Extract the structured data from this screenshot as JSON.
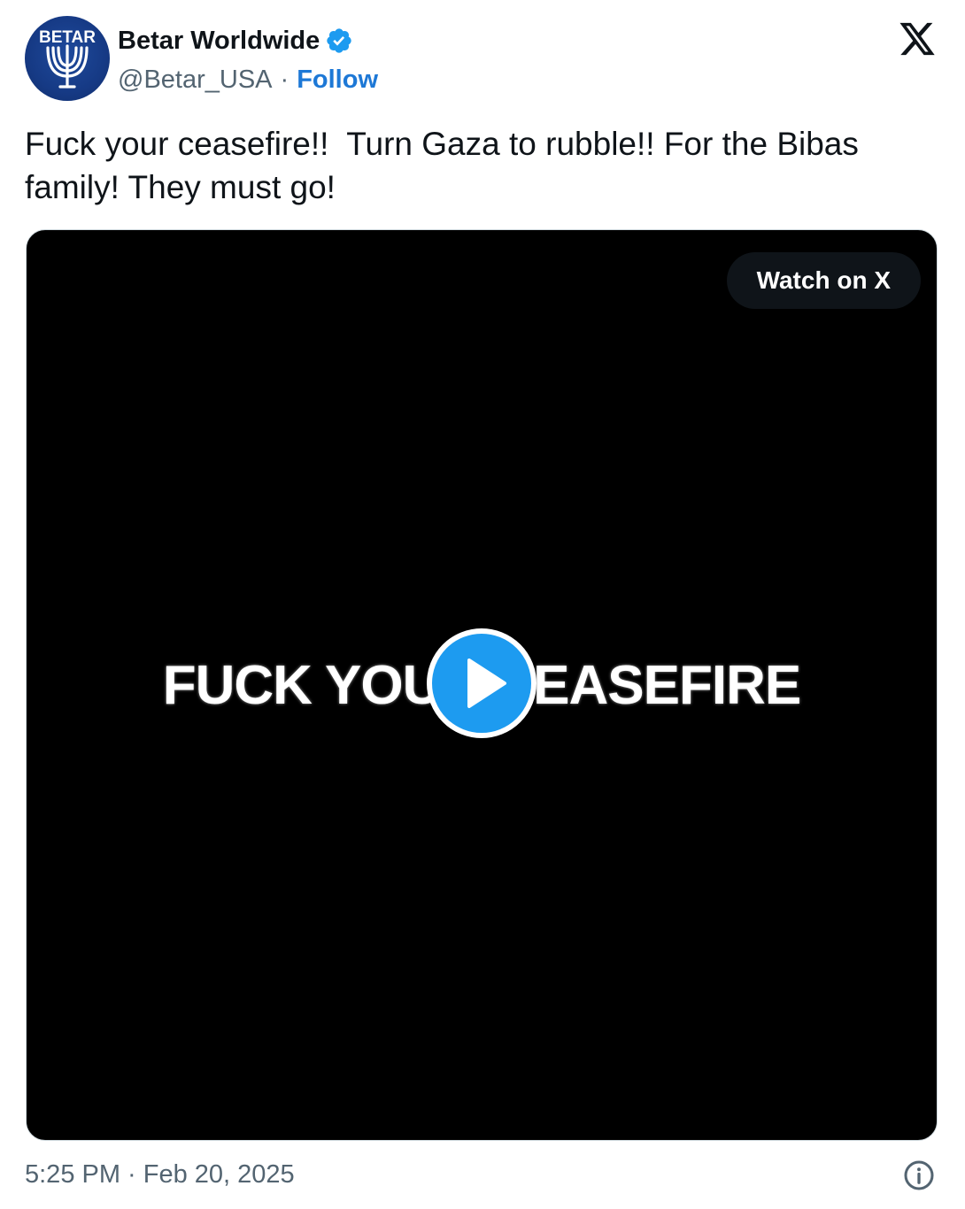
{
  "author": {
    "avatar_text": "BETAR",
    "display_name": "Betar Worldwide",
    "handle": "@Betar_USA",
    "separator": "·",
    "follow_label": "Follow",
    "verified_icon": "verified-badge-icon"
  },
  "tweet": {
    "text": "Fuck your ceasefire!!  Turn Gaza to rubble!! For the Bibas family! They must go!"
  },
  "media": {
    "watch_label": "Watch on X",
    "overlay_text": "FUCK YOUR CEASEFIRE",
    "play_icon": "play-icon"
  },
  "footer": {
    "timestamp": "5:25 PM · Feb 20, 2025",
    "info_icon": "info-icon"
  },
  "colors": {
    "accent": "#1d9bf0",
    "follow_link": "#1d78d6",
    "avatar_bg": "#163a85",
    "secondary_text": "#536471",
    "media_bg": "#000000"
  }
}
